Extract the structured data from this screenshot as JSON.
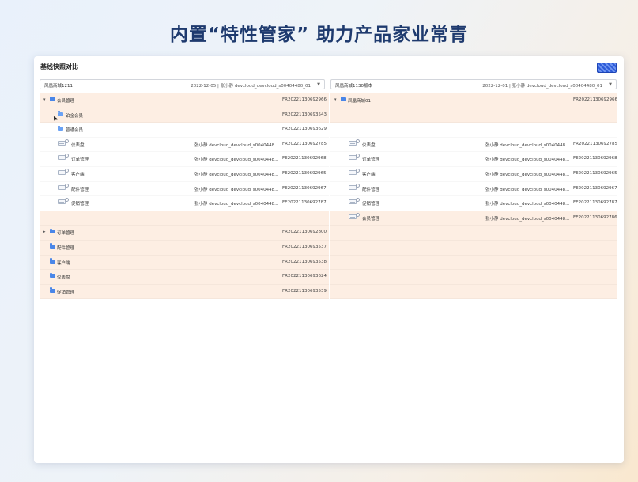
{
  "headline": "内置“特性管家” 助力产品家业常青",
  "panel": {
    "title": "基线快照对比",
    "left_select": {
      "name": "凤凰商城1211",
      "meta": "2022-12-05 | 张小静 devcloud_devcloud_s00404480_01"
    },
    "right_select": {
      "name": "凤凰商城1130版本",
      "meta": "2022-12-01 | 张小静 devcloud_devcloud_s00404480_01"
    }
  },
  "left_rows": [
    {
      "type": "group",
      "arrow": "▾",
      "label": "会员管理",
      "desc": "",
      "code": "FR20221130692966",
      "hl": true
    },
    {
      "type": "subgroup",
      "label": "铂金会员",
      "desc": "",
      "code": "FR20221130693543",
      "hl": true,
      "cursor": true
    },
    {
      "type": "subgroup",
      "label": "普通会员",
      "desc": "",
      "code": "FR20221130693629",
      "hl": false
    },
    {
      "type": "item",
      "label": "仪表盘",
      "desc": "张小静 devcloud_devcloud_s0040448...",
      "code": "FR20221130692785",
      "hl": false
    },
    {
      "type": "item",
      "label": "订单管理",
      "desc": "张小静 devcloud_devcloud_s0040448...",
      "code": "FE20221130692968",
      "hl": false
    },
    {
      "type": "item",
      "label": "客户端",
      "desc": "张小静 devcloud_devcloud_s0040448...",
      "code": "FE20221130692965",
      "hl": false
    },
    {
      "type": "item",
      "label": "配件管理",
      "desc": "张小静 devcloud_devcloud_s0040448...",
      "code": "FE20221130692967",
      "hl": false
    },
    {
      "type": "item",
      "label": "促销管理",
      "desc": "张小静 devcloud_devcloud_s0040448...",
      "code": "FE20221130692787",
      "hl": false
    },
    {
      "type": "empty",
      "label": "",
      "desc": "",
      "code": "",
      "hl": true
    },
    {
      "type": "group",
      "arrow": "▸",
      "label": "订单管理",
      "desc": "",
      "code": "FR20221130692800",
      "hl": true
    },
    {
      "type": "folder",
      "label": "配件管理",
      "desc": "",
      "code": "FR20221130693537",
      "hl": true
    },
    {
      "type": "folder",
      "label": "客户端",
      "desc": "",
      "code": "FR20221130693538",
      "hl": true
    },
    {
      "type": "folder",
      "label": "仪表盘",
      "desc": "",
      "code": "FR20221130693624",
      "hl": true
    },
    {
      "type": "folder",
      "label": "促销管理",
      "desc": "",
      "code": "FR20221130693539",
      "hl": true
    }
  ],
  "right_rows": [
    {
      "type": "group",
      "arrow": "▾",
      "label": "凤凰商城01",
      "desc": "",
      "code": "FR20221130692966",
      "hl": true
    },
    {
      "type": "empty",
      "label": "",
      "desc": "",
      "code": "",
      "hl": true
    },
    {
      "type": "empty",
      "label": "",
      "desc": "",
      "code": "",
      "hl": false
    },
    {
      "type": "item",
      "label": "仪表盘",
      "desc": "张小静 devcloud_devcloud_s0040448...",
      "code": "FR20221130692785",
      "hl": false
    },
    {
      "type": "item",
      "label": "订单管理",
      "desc": "张小静 devcloud_devcloud_s0040448...",
      "code": "FE20221130692968",
      "hl": false
    },
    {
      "type": "item",
      "label": "客户端",
      "desc": "张小静 devcloud_devcloud_s0040448...",
      "code": "FE20221130692965",
      "hl": false
    },
    {
      "type": "item",
      "label": "配件管理",
      "desc": "张小静 devcloud_devcloud_s0040448...",
      "code": "FE20221130692967",
      "hl": false
    },
    {
      "type": "item",
      "label": "促销管理",
      "desc": "张小静 devcloud_devcloud_s0040448...",
      "code": "FE20221130692787",
      "hl": false
    },
    {
      "type": "item",
      "label": "会员管理",
      "desc": "张小静 devcloud_devcloud_s0040448...",
      "code": "FE20221130692786",
      "hl": true
    },
    {
      "type": "empty",
      "label": "",
      "desc": "",
      "code": "",
      "hl": true
    },
    {
      "type": "empty",
      "label": "",
      "desc": "",
      "code": "",
      "hl": true
    },
    {
      "type": "empty",
      "label": "",
      "desc": "",
      "code": "",
      "hl": true
    },
    {
      "type": "empty",
      "label": "",
      "desc": "",
      "code": "",
      "hl": true
    },
    {
      "type": "empty",
      "label": "",
      "desc": "",
      "code": "",
      "hl": true
    }
  ],
  "colors": {
    "highlight": "#fdeee3",
    "accent": "#2d5bd8",
    "headline": "#1e3a6e"
  }
}
